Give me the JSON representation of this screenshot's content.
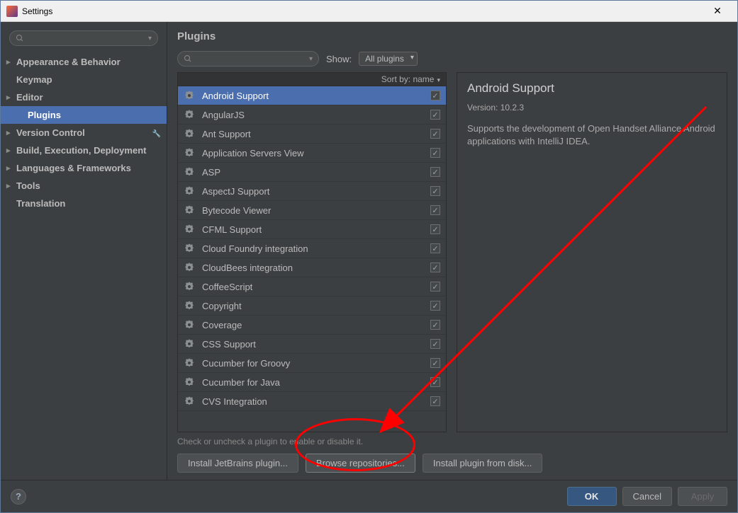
{
  "window": {
    "title": "Settings"
  },
  "sidebar": {
    "search_placeholder": "",
    "items": [
      {
        "label": "Appearance & Behavior",
        "bold": true,
        "children": true
      },
      {
        "label": "Keymap",
        "bold": true
      },
      {
        "label": "Editor",
        "bold": true,
        "children": true
      },
      {
        "label": "Plugins",
        "bold": true,
        "indent": true,
        "active": true
      },
      {
        "label": "Version Control",
        "bold": true,
        "children": true,
        "wrench": true
      },
      {
        "label": "Build, Execution, Deployment",
        "bold": true,
        "children": true
      },
      {
        "label": "Languages & Frameworks",
        "bold": true,
        "children": true
      },
      {
        "label": "Tools",
        "bold": true,
        "children": true
      },
      {
        "label": "Translation",
        "bold": true
      }
    ]
  },
  "main": {
    "heading": "Plugins",
    "search_placeholder": "",
    "show_label": "Show:",
    "filter_dropdown": "All plugins",
    "sort_label": "Sort by: name",
    "hint": "Check or uncheck a plugin to enable or disable it.",
    "install_jetbrains": "Install JetBrains plugin...",
    "browse_repos": "Browse repositories...",
    "install_disk": "Install plugin from disk..."
  },
  "plugins": [
    {
      "name": "Android Support",
      "checked": true,
      "selected": true
    },
    {
      "name": "AngularJS",
      "checked": true
    },
    {
      "name": "Ant Support",
      "checked": true
    },
    {
      "name": "Application Servers View",
      "checked": true
    },
    {
      "name": "ASP",
      "checked": true
    },
    {
      "name": "AspectJ Support",
      "checked": true
    },
    {
      "name": "Bytecode Viewer",
      "checked": true
    },
    {
      "name": "CFML Support",
      "checked": true
    },
    {
      "name": "Cloud Foundry integration",
      "checked": true
    },
    {
      "name": "CloudBees integration",
      "checked": true
    },
    {
      "name": "CoffeeScript",
      "checked": true
    },
    {
      "name": "Copyright",
      "checked": true
    },
    {
      "name": "Coverage",
      "checked": true
    },
    {
      "name": "CSS Support",
      "checked": true
    },
    {
      "name": "Cucumber for Groovy",
      "checked": true
    },
    {
      "name": "Cucumber for Java",
      "checked": true
    },
    {
      "name": "CVS Integration",
      "checked": true
    }
  ],
  "detail": {
    "title": "Android Support",
    "version_label": "Version:",
    "version": "10.2.3",
    "description": "Supports the development of Open Handset Alliance Android applications with IntelliJ IDEA."
  },
  "footer": {
    "ok": "OK",
    "cancel": "Cancel",
    "apply": "Apply"
  }
}
